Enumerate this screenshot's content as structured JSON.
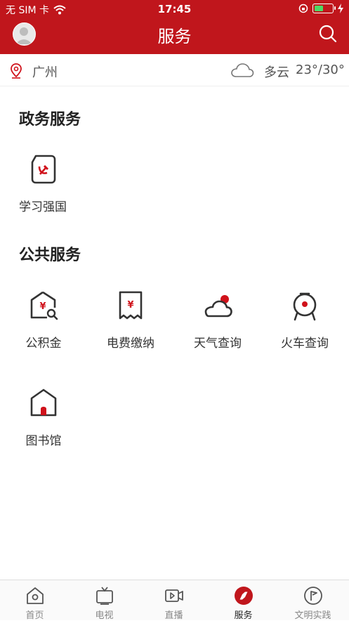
{
  "status_bar": {
    "carrier": "无 SIM 卡",
    "time": "17:45"
  },
  "nav": {
    "title": "服务"
  },
  "location": {
    "city": "广州",
    "weather": "多云",
    "temperature": "23°/30°"
  },
  "gov_section": {
    "title": "政务服务",
    "items": [
      {
        "label": "学习强国",
        "icon": "party-doc-icon"
      }
    ]
  },
  "public_section": {
    "title": "公共服务",
    "items": [
      {
        "label": "公积金",
        "icon": "house-fund-icon"
      },
      {
        "label": "电费缴纳",
        "icon": "bill-icon"
      },
      {
        "label": "天气查询",
        "icon": "weather-cloud-icon"
      },
      {
        "label": "火车查询",
        "icon": "train-icon"
      },
      {
        "label": "图书馆",
        "icon": "library-icon"
      }
    ]
  },
  "tab_bar": {
    "tabs": [
      {
        "label": "首页",
        "icon": "home-icon"
      },
      {
        "label": "电视",
        "icon": "tv-icon"
      },
      {
        "label": "直播",
        "icon": "video-icon"
      },
      {
        "label": "服务",
        "icon": "compass-icon",
        "active": true
      },
      {
        "label": "文明实践",
        "icon": "flag-icon"
      }
    ]
  },
  "colors": {
    "brand_red": "#c0161c",
    "accent_red": "#d0121b",
    "icon_gray": "#333333"
  }
}
